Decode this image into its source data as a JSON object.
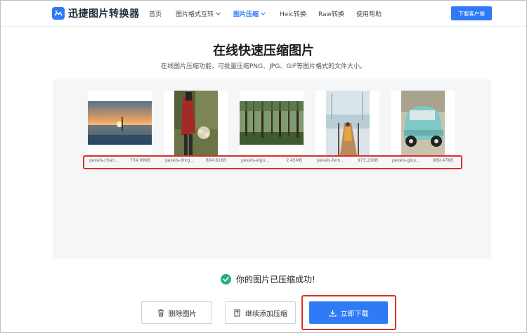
{
  "header": {
    "logo_text": "迅捷图片转换器",
    "nav": [
      {
        "label": "首页",
        "active": false,
        "dropdown": false
      },
      {
        "label": "图片格式互转",
        "active": false,
        "dropdown": true
      },
      {
        "label": "图片压缩",
        "active": true,
        "dropdown": true
      },
      {
        "label": "Heic转换",
        "active": false,
        "dropdown": false
      },
      {
        "label": "Raw转换",
        "active": false,
        "dropdown": false
      },
      {
        "label": "使用帮助",
        "active": false,
        "dropdown": false
      }
    ],
    "download_client_label": "下载客户端"
  },
  "main": {
    "title": "在线快速压缩图片",
    "subtitle": "在线图片压缩功能，可批量压缩PNG、JPG、GIF等图片格式的文件大小。"
  },
  "files": [
    {
      "name": "pexels-chan...",
      "size": "734.99KB",
      "thumb": "sunset-beach"
    },
    {
      "name": "pexels-dnrg...",
      "size": "804.61KB",
      "thumb": "red-dress-woman"
    },
    {
      "name": "pexels-elgo...",
      "size": "2.45MB",
      "thumb": "forest"
    },
    {
      "name": "pexels-fern...",
      "size": "973.21KB",
      "thumb": "pier-woman"
    },
    {
      "name": "pexels-gius...",
      "size": "969.47KB",
      "thumb": "vintage-car"
    }
  ],
  "status": {
    "message": "你的图片已压缩成功!",
    "icon": "check-circle-icon"
  },
  "actions": {
    "delete_label": "删除图片",
    "add_label": "继续添加压缩",
    "download_label": "立即下载"
  },
  "colors": {
    "accent": "#2f7bf5",
    "success": "#26b27a",
    "highlight": "#d9312b"
  }
}
